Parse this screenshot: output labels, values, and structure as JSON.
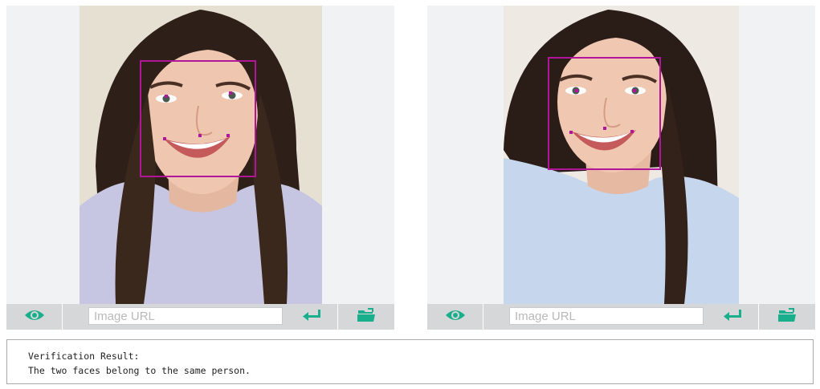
{
  "panels": [
    {
      "id": "left",
      "toolbar": {
        "view_icon": "eye-icon",
        "url_placeholder": "Image URL",
        "submit_icon": "enter-icon",
        "open_icon": "folder-icon"
      }
    },
    {
      "id": "right",
      "toolbar": {
        "view_icon": "eye-icon",
        "url_placeholder": "Image URL",
        "submit_icon": "enter-icon",
        "open_icon": "folder-icon"
      }
    }
  ],
  "result": {
    "heading": "Verification Result:",
    "message": "The two faces belong to the same person."
  },
  "colors": {
    "accent": "#1aaf8c",
    "face_box": "#b0159a",
    "toolbar_bg": "#d6d7d8",
    "image_bg": "#f1f2f4"
  }
}
